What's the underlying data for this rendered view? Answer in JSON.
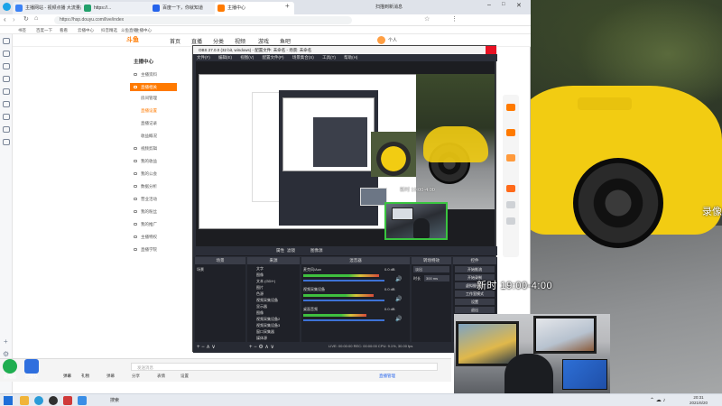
{
  "browser": {
    "tabs": [
      {
        "label": "主播网站 - 视频点播 大流量高清",
        "color": "#3b82f6"
      },
      {
        "label": "https://...",
        "color": "#22a06b"
      },
      {
        "label": "百度一下，你就知道",
        "color": "#2563eb"
      },
      {
        "label": "主播中心",
        "color": "#ff7a00"
      }
    ],
    "active_tab": "主播中心",
    "url": "https://hsp.douyu.com/live/index",
    "bookmarks": [
      "书签",
      "百度一下",
      "看看",
      "云播中心",
      "抖音精选",
      "斗鱼直播",
      "主播中心"
    ],
    "toolbar_right": "扫描到新消息",
    "site": {
      "logo": "斗鱼",
      "nav": [
        "首页",
        "直播",
        "分类",
        "视频",
        "游戏",
        "鱼吧"
      ],
      "user": "个人"
    },
    "menu": {
      "title": "主播中心",
      "items": [
        {
          "label": "主播资料",
          "state": "normal"
        },
        {
          "label": "直播相关",
          "state": "active"
        },
        {
          "label": "房间管理",
          "state": "normal"
        },
        {
          "label": "直播设置",
          "state": "sub"
        },
        {
          "label": "直播记录",
          "state": "normal"
        },
        {
          "label": "收益概况",
          "state": "normal"
        },
        {
          "label": "视频剪辑",
          "state": "normal"
        },
        {
          "label": "我的收益",
          "state": "normal"
        },
        {
          "label": "我的公会",
          "state": "normal"
        },
        {
          "label": "数据分析",
          "state": "normal"
        },
        {
          "label": "营业活动",
          "state": "normal"
        },
        {
          "label": "我的粉丝",
          "state": "normal"
        },
        {
          "label": "我的推广",
          "state": "normal"
        },
        {
          "label": "主播特权",
          "state": "normal"
        },
        {
          "label": "直播学院",
          "state": "normal"
        }
      ]
    }
  },
  "obs": {
    "title": "OBS 27.0.0 (32 bit, windows) - 配置文件: 未命名 - 场景: 未命名",
    "menu": [
      "文件(F)",
      "编辑(E)",
      "视图(V)",
      "配置文件(P)",
      "场景集合(S)",
      "工具(T)",
      "帮助(H)"
    ],
    "time_overlay": "新时 19:00-4:00",
    "toolbar": [
      "属性",
      "滤镜",
      "图像源"
    ],
    "docks": {
      "scenes": "场景",
      "sources": "来源",
      "mixer": "混音器",
      "transitions": "转场特效",
      "controls": "控件"
    },
    "scene_list": [
      "场景"
    ],
    "source_list": [
      "文字",
      "图像",
      "文本 (GDI+)",
      "图片",
      "色源",
      "视频采集设备",
      "显示器",
      "图像",
      "视频采集设备2",
      "视频采集设备3",
      "窗口采集器",
      "媒体源"
    ],
    "mixer_channels": [
      {
        "name": "麦克风/Aux",
        "level": 0.72,
        "db": "0.0 dB"
      },
      {
        "name": "视频采集设备",
        "level": 0.65,
        "db": "0.0 dB"
      },
      {
        "name": "桌面音频",
        "level": 0.58,
        "db": "0.0 dB"
      }
    ],
    "transition": {
      "name": "淡出",
      "duration_label": "时长",
      "duration": "300 ms"
    },
    "controls": [
      "开始推流",
      "开始录制",
      "虚拟摄像机",
      "工作室模式",
      "设置",
      "退出"
    ],
    "status": "LIVE: 00:00:00  REC: 00:00:00  CPU: 9.1%, 30.00 fps"
  },
  "overlay": {
    "schedule": "新时 19:00-4:00",
    "record_label": "录像"
  },
  "chat_bar": {
    "placeholder": "发送消息",
    "left_labels": [
      "弹幕",
      "礼物"
    ],
    "tools": [
      "弹幕",
      "分享",
      "表情",
      "设置"
    ],
    "right_label": "直播管理"
  },
  "desktop_icons": [
    {
      "label": "此电脑",
      "color": "#1fae50"
    },
    {
      "label": "回收站",
      "color": "#2f6fde"
    }
  ],
  "taskbar": {
    "search_text": "搜索",
    "pinned": [
      "文件资源管理器",
      "浏览器",
      "OBS",
      "微信",
      "QQ"
    ],
    "clock_time": "20:31",
    "clock_date": "2021/6/20"
  }
}
